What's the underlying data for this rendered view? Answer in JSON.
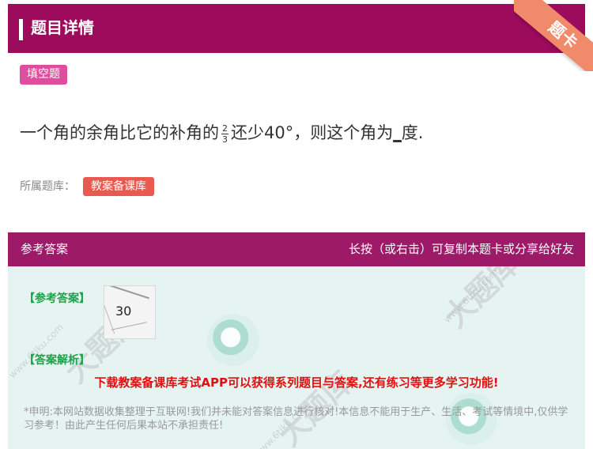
{
  "header": {
    "title": "题目详情",
    "corner_label": "题卡"
  },
  "question": {
    "type_badge": "填空题",
    "text_before": "一个角的余角比它的补角的",
    "fraction": {
      "numerator": "2",
      "denominator": "3"
    },
    "text_after_1": "还少40°，则这个角为",
    "blank": "_",
    "text_after_2": "度."
  },
  "library": {
    "label": "所属题库：",
    "tag": "教案备课库"
  },
  "answer_bar": {
    "left": "参考答案",
    "right": "长按（或右击）可复制本题卡或分享给好友"
  },
  "answer": {
    "ref_label": "【参考答案】",
    "image_text": "30",
    "analysis_label": "【答案解析】",
    "promo": "下载教案备课库考试APP可以获得系列题目与答案,还有练习等更多学习功能!",
    "disclaimer": "*申明:本网站数据收集整理于互联网!我们并未能对答案信息进行核对!本信息不能用于生产、生活、考试等情境中,仅供学习参考！由此产生任何后果本站不承担责任!"
  },
  "colors": {
    "header": "#9c0b5c",
    "badge": "#e04d9f",
    "tag": "#e85a4f",
    "promo": "#e01010",
    "green": "#1aa34a"
  }
}
